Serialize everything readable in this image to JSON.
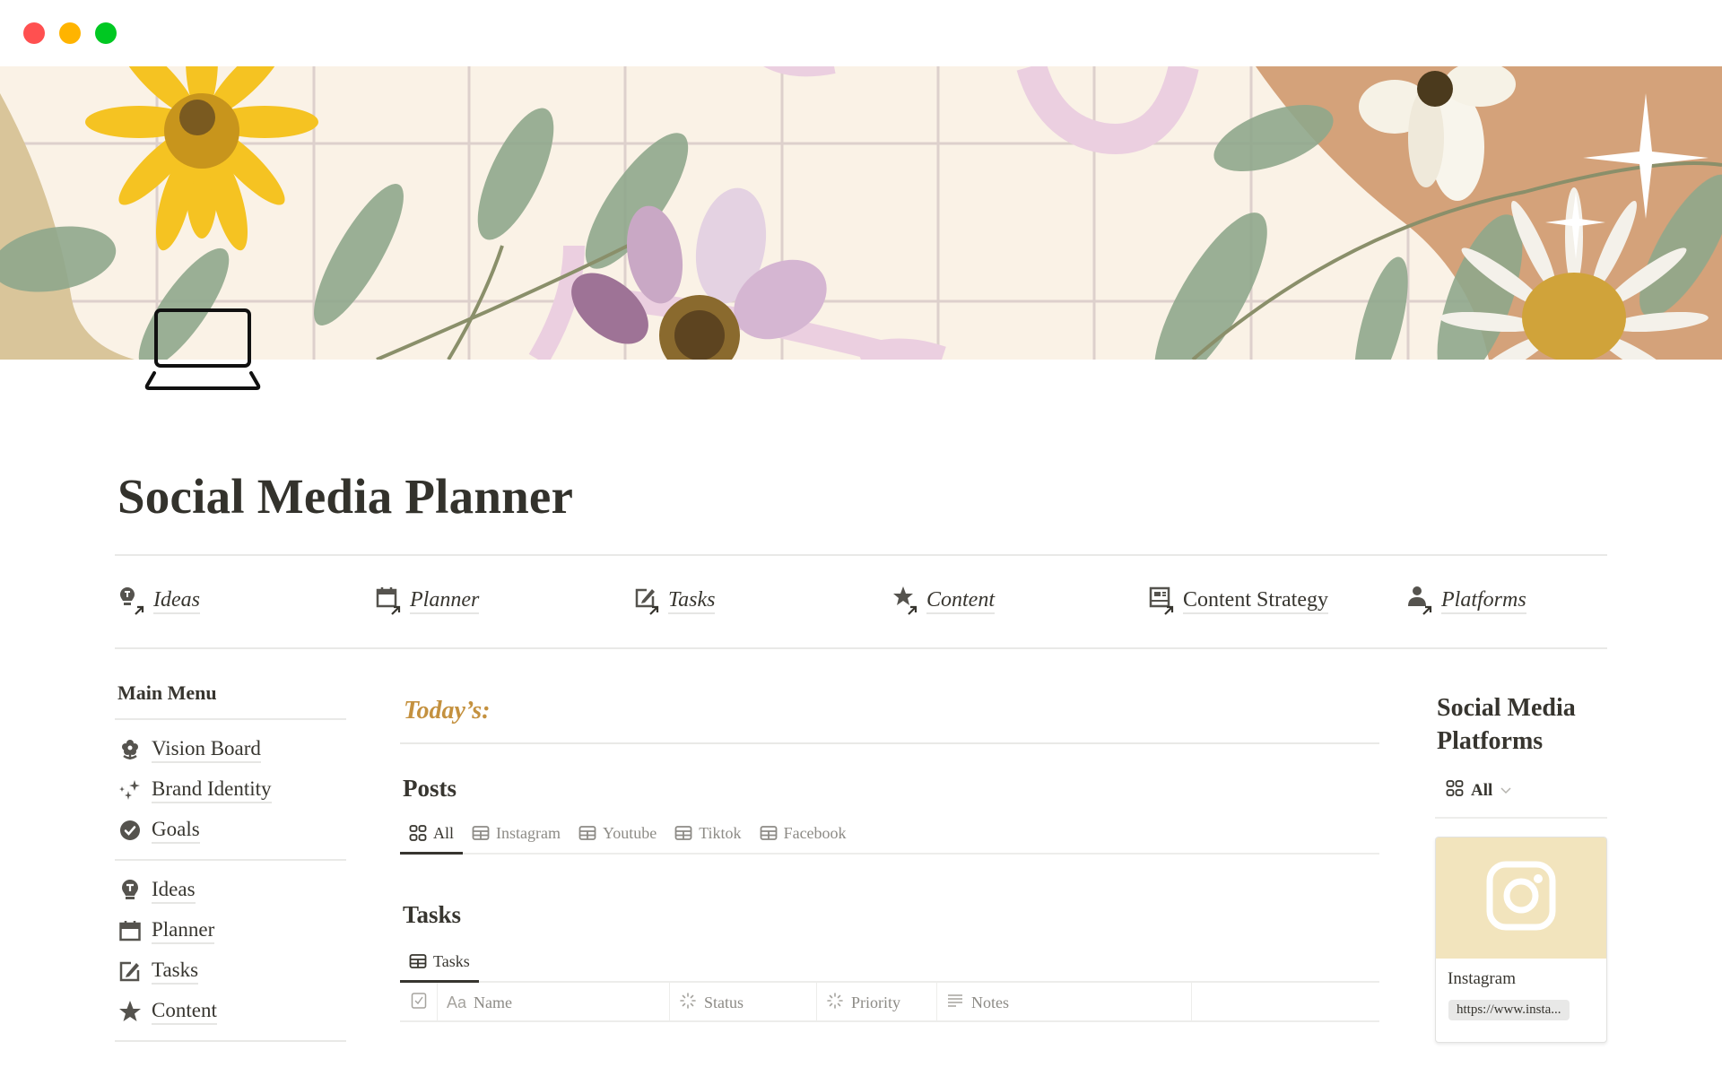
{
  "window": {
    "controls": [
      "close",
      "minimize",
      "maximize"
    ]
  },
  "page": {
    "title": "Social Media Planner",
    "icon": "laptop-icon"
  },
  "nav": [
    {
      "label": "Ideas",
      "icon": "lightbulb-icon"
    },
    {
      "label": "Planner",
      "icon": "calendar-icon"
    },
    {
      "label": "Tasks",
      "icon": "edit-icon"
    },
    {
      "label": "Content",
      "icon": "star-icon"
    },
    {
      "label": "Content Strategy",
      "icon": "layout-icon"
    },
    {
      "label": "Platforms",
      "icon": "person-icon"
    }
  ],
  "sidebar": {
    "heading": "Main Menu",
    "group1": [
      {
        "label": "Vision Board",
        "icon": "flower-icon"
      },
      {
        "label": "Brand Identity",
        "icon": "sparkles-icon"
      },
      {
        "label": "Goals",
        "icon": "check-circle-icon"
      }
    ],
    "group2": [
      {
        "label": "Ideas",
        "icon": "lightbulb-icon"
      },
      {
        "label": "Planner",
        "icon": "calendar-icon"
      },
      {
        "label": "Tasks",
        "icon": "edit-icon"
      },
      {
        "label": "Content",
        "icon": "star-icon"
      }
    ]
  },
  "main": {
    "today_heading": "Today’s:",
    "posts": {
      "heading": "Posts",
      "tabs": [
        {
          "label": "All",
          "icon": "gallery-icon",
          "active": true
        },
        {
          "label": "Instagram",
          "icon": "table-icon"
        },
        {
          "label": "Youtube",
          "icon": "table-icon"
        },
        {
          "label": "Tiktok",
          "icon": "table-icon"
        },
        {
          "label": "Facebook",
          "icon": "table-icon"
        }
      ]
    },
    "tasks": {
      "heading": "Tasks",
      "tabs": [
        {
          "label": "Tasks",
          "icon": "table-icon",
          "active": true
        }
      ],
      "columns": [
        {
          "label": "",
          "icon": "checkbox-icon"
        },
        {
          "label": "Name",
          "icon": "text-icon"
        },
        {
          "label": "Status",
          "icon": "status-icon"
        },
        {
          "label": "Priority",
          "icon": "status-icon"
        },
        {
          "label": "Notes",
          "icon": "lines-icon"
        }
      ]
    }
  },
  "right": {
    "heading": "Social Media Platforms",
    "view": {
      "label": "All",
      "icon": "gallery-icon"
    },
    "cards": [
      {
        "title": "Instagram",
        "url": "https://www.insta...",
        "cover_color": "#f2e4bd",
        "icon": "instagram-icon"
      }
    ]
  },
  "colors": {
    "accent_today": "#c4913f",
    "text": "#37352f",
    "card_cover": "#f2e4bd"
  }
}
